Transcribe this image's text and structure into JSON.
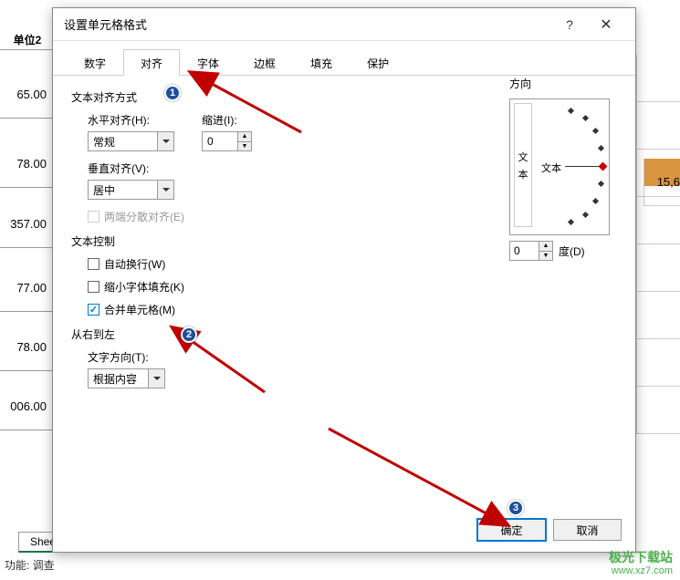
{
  "bg": {
    "header": "单位2",
    "cells": [
      "65.00",
      "78.00",
      "357.00",
      "77.00",
      "78.00",
      "006.00"
    ],
    "right_val": "15,6",
    "sheet_tab": "Sheet",
    "status": "功能: 调查"
  },
  "dialog": {
    "title": "设置单元格格式",
    "tabs": [
      "数字",
      "对齐",
      "字体",
      "边框",
      "填充",
      "保护"
    ],
    "section_align": "文本对齐方式",
    "h_align_label": "水平对齐(H):",
    "h_align_value": "常规",
    "indent_label": "缩进(I):",
    "indent_value": "0",
    "v_align_label": "垂直对齐(V):",
    "v_align_value": "居中",
    "justify_label": "两端分散对齐(E)",
    "section_ctrl": "文本控制",
    "wrap_label": "自动换行(W)",
    "shrink_label": "缩小字体填充(K)",
    "merge_label": "合并单元格(M)",
    "section_rtl": "从右到左",
    "text_dir_label": "文字方向(T):",
    "text_dir_value": "根据内容",
    "orient_label": "方向",
    "vert_char1": "文",
    "vert_char2": "本",
    "arc_text": "文本",
    "degree_value": "0",
    "degree_label": "度(D)",
    "ok": "确定",
    "cancel": "取消"
  },
  "badges": {
    "b1": "1",
    "b2": "2",
    "b3": "3"
  },
  "watermark": {
    "line1": "极光下载站",
    "line2": "www.xz7.com"
  }
}
